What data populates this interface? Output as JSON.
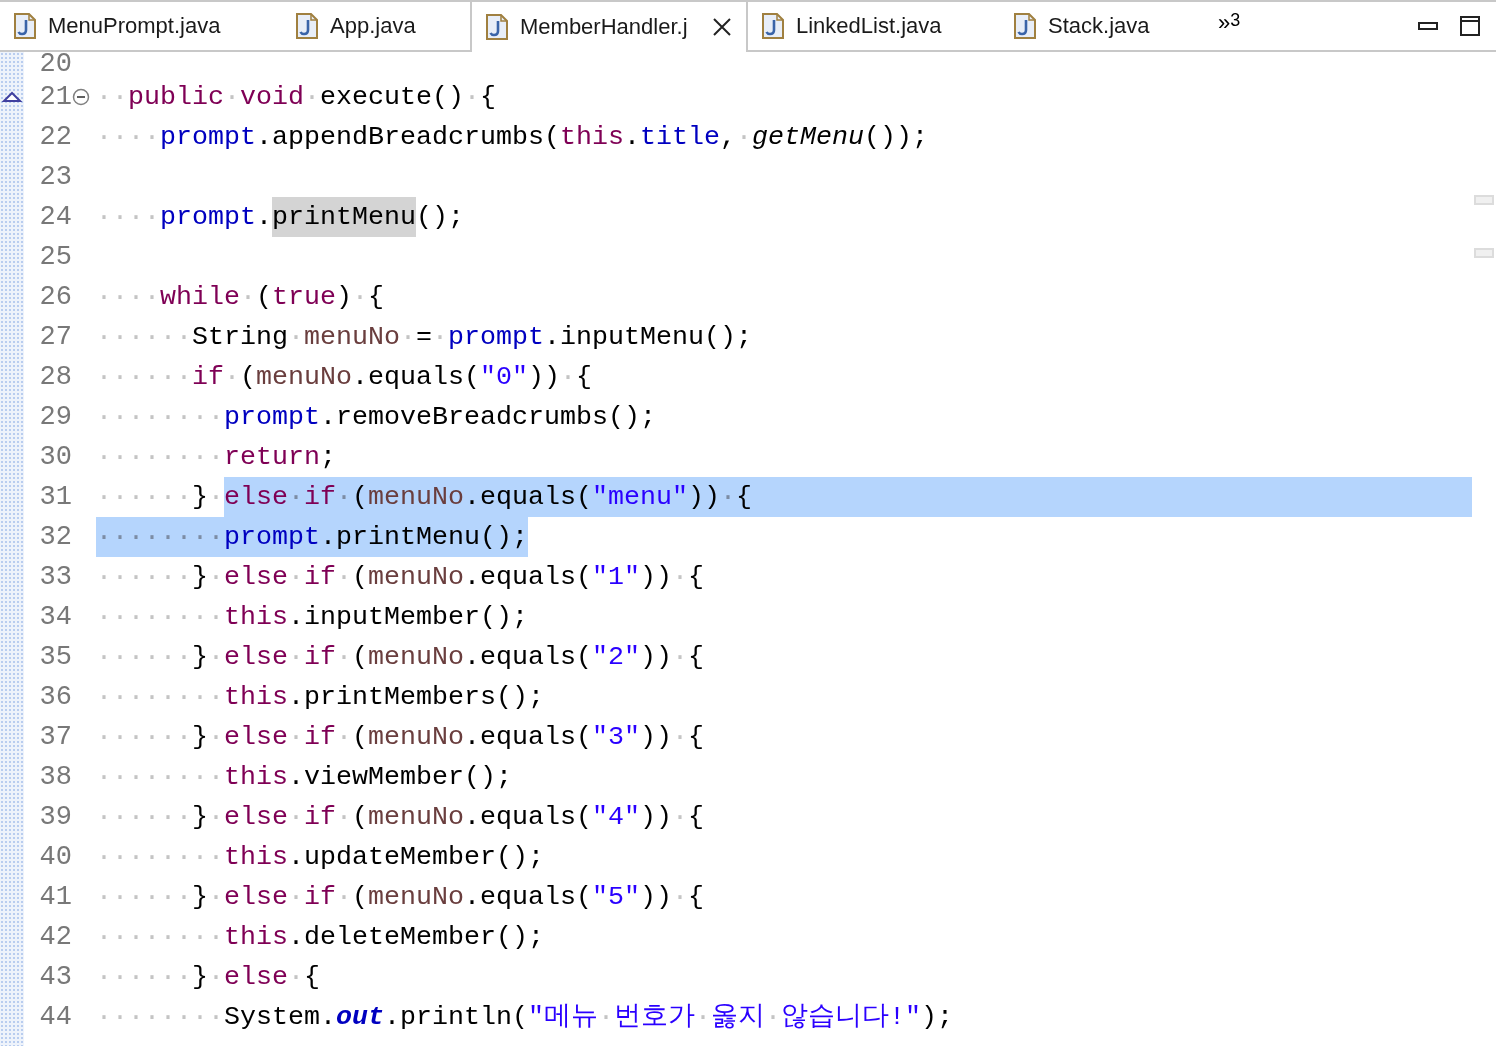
{
  "tabs": [
    {
      "label": "MenuPrompt.java",
      "selected": false
    },
    {
      "label": "App.java",
      "selected": false
    },
    {
      "label": "MemberHandler.j",
      "selected": true
    },
    {
      "label": "LinkedList.java",
      "selected": false
    },
    {
      "label": "Stack.java",
      "selected": false
    }
  ],
  "overflow": {
    "label": "»",
    "count": "3"
  },
  "lines": [
    {
      "number": "20",
      "kind": "partial"
    },
    {
      "number": "21",
      "kind": "method",
      "tokens": [
        {
          "kind": "ws",
          "text": "··"
        },
        {
          "kind": "keyword",
          "text": "public"
        },
        {
          "kind": "ws",
          "text": "·"
        },
        {
          "kind": "keyword",
          "text": "void"
        },
        {
          "kind": "ws",
          "text": "·"
        },
        {
          "kind": "plain",
          "text": "execute()"
        },
        {
          "kind": "ws",
          "text": "·"
        },
        {
          "kind": "plain",
          "text": "{"
        }
      ]
    },
    {
      "number": "22",
      "kind": "plain",
      "tokens": [
        {
          "kind": "ws",
          "text": "····"
        },
        {
          "kind": "field",
          "text": "prompt"
        },
        {
          "kind": "plain",
          "text": ".appendBreadcrumbs("
        },
        {
          "kind": "keyword",
          "text": "this"
        },
        {
          "kind": "plain",
          "text": "."
        },
        {
          "kind": "field",
          "text": "title"
        },
        {
          "kind": "plain",
          "text": ","
        },
        {
          "kind": "ws",
          "text": "·"
        },
        {
          "kind": "static-method",
          "text": "getMenu"
        },
        {
          "kind": "plain",
          "text": "());"
        }
      ]
    },
    {
      "number": "23",
      "kind": "plain"
    },
    {
      "number": "24",
      "kind": "plain",
      "tokens": [
        {
          "kind": "ws",
          "text": "····"
        },
        {
          "kind": "field",
          "text": "prompt"
        },
        {
          "kind": "plain",
          "text": "."
        },
        {
          "kind": "occurrence",
          "text": "printMenu"
        },
        {
          "kind": "plain",
          "text": "();"
        }
      ]
    },
    {
      "number": "25",
      "kind": "plain"
    },
    {
      "number": "26",
      "kind": "plain",
      "tokens": [
        {
          "kind": "ws",
          "text": "····"
        },
        {
          "kind": "keyword",
          "text": "while"
        },
        {
          "kind": "ws",
          "text": "·"
        },
        {
          "kind": "plain",
          "text": "("
        },
        {
          "kind": "keyword",
          "text": "true"
        },
        {
          "kind": "plain",
          "text": ")"
        },
        {
          "kind": "ws",
          "text": "·"
        },
        {
          "kind": "plain",
          "text": "{"
        }
      ]
    },
    {
      "number": "27",
      "kind": "plain",
      "tokens": [
        {
          "kind": "ws",
          "text": "······"
        },
        {
          "kind": "plain",
          "text": "String"
        },
        {
          "kind": "ws",
          "text": "·"
        },
        {
          "kind": "local",
          "text": "menuNo"
        },
        {
          "kind": "ws",
          "text": "·"
        },
        {
          "kind": "plain",
          "text": "="
        },
        {
          "kind": "ws",
          "text": "·"
        },
        {
          "kind": "field",
          "text": "prompt"
        },
        {
          "kind": "plain",
          "text": ".inputMenu();"
        }
      ]
    },
    {
      "number": "28",
      "kind": "plain",
      "tokens": [
        {
          "kind": "ws",
          "text": "······"
        },
        {
          "kind": "keyword",
          "text": "if"
        },
        {
          "kind": "ws",
          "text": "·"
        },
        {
          "kind": "plain",
          "text": "("
        },
        {
          "kind": "local",
          "text": "menuNo"
        },
        {
          "kind": "plain",
          "text": ".equals("
        },
        {
          "kind": "string",
          "text": "\"0\""
        },
        {
          "kind": "plain",
          "text": "))"
        },
        {
          "kind": "ws",
          "text": "·"
        },
        {
          "kind": "plain",
          "text": "{"
        }
      ]
    },
    {
      "number": "29",
      "kind": "plain",
      "tokens": [
        {
          "kind": "ws",
          "text": "········"
        },
        {
          "kind": "field",
          "text": "prompt"
        },
        {
          "kind": "plain",
          "text": ".removeBreadcrumbs();"
        }
      ]
    },
    {
      "number": "30",
      "kind": "plain",
      "tokens": [
        {
          "kind": "ws",
          "text": "········"
        },
        {
          "kind": "keyword",
          "text": "return"
        },
        {
          "kind": "plain",
          "text": ";"
        }
      ]
    },
    {
      "number": "31",
      "kind": "selected-to-end",
      "tokens": [
        {
          "kind": "ws",
          "text": "······"
        },
        {
          "kind": "plain",
          "text": "}"
        },
        {
          "kind": "ws",
          "text": "·"
        }
      ],
      "selected_tokens": [
        {
          "kind": "keyword",
          "text": "else"
        },
        {
          "kind": "ws",
          "text": "·"
        },
        {
          "kind": "keyword",
          "text": "if"
        },
        {
          "kind": "ws",
          "text": "·"
        },
        {
          "kind": "plain",
          "text": "("
        },
        {
          "kind": "local",
          "text": "menuNo"
        },
        {
          "kind": "plain",
          "text": ".equals("
        },
        {
          "kind": "string",
          "text": "\"menu\""
        },
        {
          "kind": "plain",
          "text": "))"
        },
        {
          "kind": "ws",
          "text": "·"
        },
        {
          "kind": "plain",
          "text": "{"
        }
      ]
    },
    {
      "number": "32",
      "kind": "plain",
      "selected_tokens": [
        {
          "kind": "ws",
          "text": "········"
        },
        {
          "kind": "field",
          "text": "prompt"
        },
        {
          "kind": "plain",
          "text": ".printMenu();"
        }
      ]
    },
    {
      "number": "33",
      "kind": "plain",
      "tokens": [
        {
          "kind": "ws",
          "text": "······"
        },
        {
          "kind": "plain",
          "text": "}"
        },
        {
          "kind": "ws",
          "text": "·"
        },
        {
          "kind": "keyword",
          "text": "else"
        },
        {
          "kind": "ws",
          "text": "·"
        },
        {
          "kind": "keyword",
          "text": "if"
        },
        {
          "kind": "ws",
          "text": "·"
        },
        {
          "kind": "plain",
          "text": "("
        },
        {
          "kind": "local",
          "text": "menuNo"
        },
        {
          "kind": "plain",
          "text": ".equals("
        },
        {
          "kind": "string",
          "text": "\"1\""
        },
        {
          "kind": "plain",
          "text": "))"
        },
        {
          "kind": "ws",
          "text": "·"
        },
        {
          "kind": "plain",
          "text": "{"
        }
      ]
    },
    {
      "number": "34",
      "kind": "plain",
      "tokens": [
        {
          "kind": "ws",
          "text": "········"
        },
        {
          "kind": "keyword",
          "text": "this"
        },
        {
          "kind": "plain",
          "text": ".inputMember();"
        }
      ]
    },
    {
      "number": "35",
      "kind": "plain",
      "tokens": [
        {
          "kind": "ws",
          "text": "······"
        },
        {
          "kind": "plain",
          "text": "}"
        },
        {
          "kind": "ws",
          "text": "·"
        },
        {
          "kind": "keyword",
          "text": "else"
        },
        {
          "kind": "ws",
          "text": "·"
        },
        {
          "kind": "keyword",
          "text": "if"
        },
        {
          "kind": "ws",
          "text": "·"
        },
        {
          "kind": "plain",
          "text": "("
        },
        {
          "kind": "local",
          "text": "menuNo"
        },
        {
          "kind": "plain",
          "text": ".equals("
        },
        {
          "kind": "string",
          "text": "\"2\""
        },
        {
          "kind": "plain",
          "text": "))"
        },
        {
          "kind": "ws",
          "text": "·"
        },
        {
          "kind": "plain",
          "text": "{"
        }
      ]
    },
    {
      "number": "36",
      "kind": "plain",
      "tokens": [
        {
          "kind": "ws",
          "text": "········"
        },
        {
          "kind": "keyword",
          "text": "this"
        },
        {
          "kind": "plain",
          "text": ".printMembers();"
        }
      ]
    },
    {
      "number": "37",
      "kind": "plain",
      "tokens": [
        {
          "kind": "ws",
          "text": "······"
        },
        {
          "kind": "plain",
          "text": "}"
        },
        {
          "kind": "ws",
          "text": "·"
        },
        {
          "kind": "keyword",
          "text": "else"
        },
        {
          "kind": "ws",
          "text": "·"
        },
        {
          "kind": "keyword",
          "text": "if"
        },
        {
          "kind": "ws",
          "text": "·"
        },
        {
          "kind": "plain",
          "text": "("
        },
        {
          "kind": "local",
          "text": "menuNo"
        },
        {
          "kind": "plain",
          "text": ".equals("
        },
        {
          "kind": "string",
          "text": "\"3\""
        },
        {
          "kind": "plain",
          "text": "))"
        },
        {
          "kind": "ws",
          "text": "·"
        },
        {
          "kind": "plain",
          "text": "{"
        }
      ]
    },
    {
      "number": "38",
      "kind": "plain",
      "tokens": [
        {
          "kind": "ws",
          "text": "········"
        },
        {
          "kind": "keyword",
          "text": "this"
        },
        {
          "kind": "plain",
          "text": ".viewMember();"
        }
      ]
    },
    {
      "number": "39",
      "kind": "plain",
      "tokens": [
        {
          "kind": "ws",
          "text": "······"
        },
        {
          "kind": "plain",
          "text": "}"
        },
        {
          "kind": "ws",
          "text": "·"
        },
        {
          "kind": "keyword",
          "text": "else"
        },
        {
          "kind": "ws",
          "text": "·"
        },
        {
          "kind": "keyword",
          "text": "if"
        },
        {
          "kind": "ws",
          "text": "·"
        },
        {
          "kind": "plain",
          "text": "("
        },
        {
          "kind": "local",
          "text": "menuNo"
        },
        {
          "kind": "plain",
          "text": ".equals("
        },
        {
          "kind": "string",
          "text": "\"4\""
        },
        {
          "kind": "plain",
          "text": "))"
        },
        {
          "kind": "ws",
          "text": "·"
        },
        {
          "kind": "plain",
          "text": "{"
        }
      ]
    },
    {
      "number": "40",
      "kind": "plain",
      "tokens": [
        {
          "kind": "ws",
          "text": "········"
        },
        {
          "kind": "keyword",
          "text": "this"
        },
        {
          "kind": "plain",
          "text": ".updateMember();"
        }
      ]
    },
    {
      "number": "41",
      "kind": "plain",
      "tokens": [
        {
          "kind": "ws",
          "text": "······"
        },
        {
          "kind": "plain",
          "text": "}"
        },
        {
          "kind": "ws",
          "text": "·"
        },
        {
          "kind": "keyword",
          "text": "else"
        },
        {
          "kind": "ws",
          "text": "·"
        },
        {
          "kind": "keyword",
          "text": "if"
        },
        {
          "kind": "ws",
          "text": "·"
        },
        {
          "kind": "plain",
          "text": "("
        },
        {
          "kind": "local",
          "text": "menuNo"
        },
        {
          "kind": "plain",
          "text": ".equals("
        },
        {
          "kind": "string",
          "text": "\"5\""
        },
        {
          "kind": "plain",
          "text": "))"
        },
        {
          "kind": "ws",
          "text": "·"
        },
        {
          "kind": "plain",
          "text": "{"
        }
      ]
    },
    {
      "number": "42",
      "kind": "plain",
      "tokens": [
        {
          "kind": "ws",
          "text": "········"
        },
        {
          "kind": "keyword",
          "text": "this"
        },
        {
          "kind": "plain",
          "text": ".deleteMember();"
        }
      ]
    },
    {
      "number": "43",
      "kind": "plain",
      "tokens": [
        {
          "kind": "ws",
          "text": "······"
        },
        {
          "kind": "plain",
          "text": "}"
        },
        {
          "kind": "ws",
          "text": "·"
        },
        {
          "kind": "keyword",
          "text": "else"
        },
        {
          "kind": "ws",
          "text": "·"
        },
        {
          "kind": "plain",
          "text": "{"
        }
      ]
    },
    {
      "number": "44",
      "kind": "plain",
      "tokens": [
        {
          "kind": "ws",
          "text": "········"
        },
        {
          "kind": "plain",
          "text": "System."
        },
        {
          "kind": "static-field",
          "text": "out"
        },
        {
          "kind": "plain",
          "text": ".println("
        },
        {
          "kind": "string",
          "text": "\"메뉴"
        },
        {
          "kind": "ws",
          "text": "·"
        },
        {
          "kind": "string",
          "text": "번호가"
        },
        {
          "kind": "ws",
          "text": "·"
        },
        {
          "kind": "string",
          "text": "옳지"
        },
        {
          "kind": "ws",
          "text": "·"
        },
        {
          "kind": "string",
          "text": "않습니다!\""
        },
        {
          "kind": "plain",
          "text": ");"
        }
      ]
    }
  ]
}
